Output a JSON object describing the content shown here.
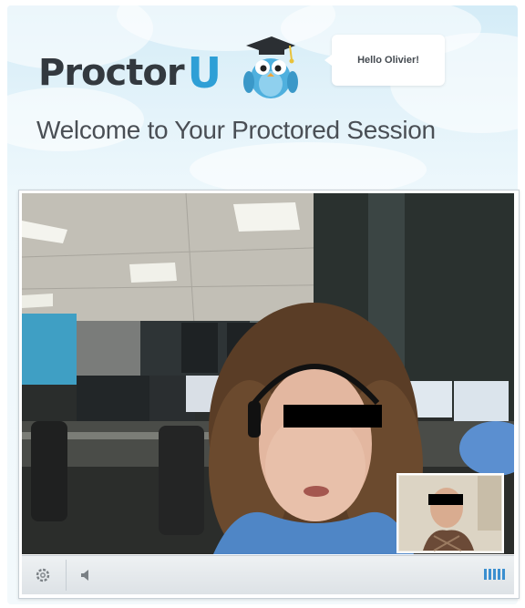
{
  "header": {
    "logo_text": "Proctor",
    "logo_letter": "U",
    "greeting": "Hello Olivier!",
    "brand_color": "#2e9fd6"
  },
  "main": {
    "title": "Welcome to Your Proctored Session"
  },
  "video": {
    "controls": {
      "settings_icon": "gear-icon",
      "volume_icon": "speaker-icon",
      "signal_icon": "signal-bars-icon",
      "signal_bars": 5,
      "accent": "#3b8fd0"
    }
  }
}
